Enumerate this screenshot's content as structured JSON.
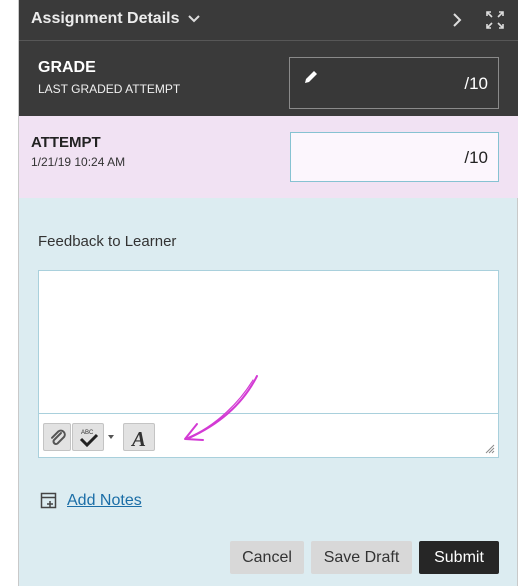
{
  "header": {
    "title": "Assignment Details",
    "icons": {
      "collapse": "chevron-down-icon",
      "next": "chevron-right-icon",
      "fullscreen": "expand-icon"
    }
  },
  "grade": {
    "label": "GRADE",
    "sublabel": "LAST GRADED ATTEMPT",
    "value": "/10",
    "icon": "pencil-icon"
  },
  "attempt": {
    "label": "ATTEMPT",
    "timestamp": "1/21/19 10:24 AM",
    "value": "/10"
  },
  "feedback": {
    "label": "Feedback to Learner",
    "text": "",
    "toolbar": [
      "paperclip-icon",
      "spellcheck-icon",
      "format-text-icon"
    ]
  },
  "notes": {
    "label": "Add Notes"
  },
  "actions": {
    "cancel": "Cancel",
    "save_draft": "Save Draft",
    "submit": "Submit"
  },
  "colors": {
    "header_bg": "#3a3a3a",
    "attempt_bg": "#f1e2f3",
    "panel_bg": "#dcecf1",
    "link": "#1b6ea7",
    "annotation_arrow": "#d33ad4",
    "submit_bg": "#262626"
  }
}
